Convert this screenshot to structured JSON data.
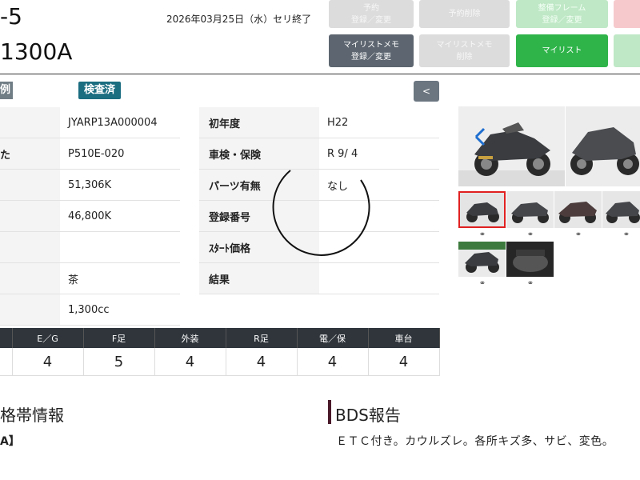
{
  "header": {
    "lot_no": "-5",
    "model": "1300A",
    "auction_date": "2026年03月25日（水）セリ終了"
  },
  "buttons": {
    "reserve": [
      "予約",
      "登録／変更"
    ],
    "reserve_delete": "予約削除",
    "frame": [
      "整備フレーム",
      "登録／変更"
    ],
    "mylist_memo": [
      "マイリストメモ",
      "登録／変更"
    ],
    "mylist_memo_delete": [
      "マイリストメモ",
      "削除"
    ],
    "mylist": "マイリスト"
  },
  "badges": {
    "example": "例",
    "inspected": "検査済",
    "collapse": "<"
  },
  "spec_left": [
    {
      "label": "",
      "value": "JYARP13A000004"
    },
    {
      "label": "",
      "value": "P510E-020"
    },
    {
      "label": "",
      "value": "51,306K"
    },
    {
      "label": "",
      "value": "46,800K"
    },
    {
      "label": "",
      "value": ""
    },
    {
      "label": "",
      "value": "茶"
    },
    {
      "label": "",
      "value": "1,300cc"
    }
  ],
  "spec_right": [
    {
      "label": "初年度",
      "value": "H22"
    },
    {
      "label": "車検・保険",
      "value": "R 9/ 4"
    },
    {
      "label": "パーツ有無",
      "value": "なし"
    },
    {
      "label": "登録番号",
      "value": ""
    },
    {
      "label": "ｽﾀｰﾄ価格",
      "value": ""
    },
    {
      "label": "結果",
      "value": ""
    }
  ],
  "spec_left_label_fragments": [
    "",
    "",
    "",
    "",
    "",
    "",
    ""
  ],
  "spec_left_label_fragment_2": "た",
  "grades": {
    "headers": [
      "",
      "E／G",
      "F足",
      "外装",
      "R足",
      "電／保",
      "車台"
    ],
    "values": [
      "",
      "4",
      "5",
      "4",
      "4",
      "4",
      "4"
    ]
  },
  "sections": {
    "left_title": "格帯情報",
    "left_sub": "A】",
    "right_title": "BDS報告",
    "report_text": "ＥＴＣ付き。カウルズレ。各所キズ多、サビ、変色。"
  },
  "icons": {
    "link": "link-icon",
    "loading": "spinner-icon"
  },
  "colors": {
    "green": "#2fb44a",
    "dark_button": "#5d6670",
    "inspected_badge": "#1b6d80",
    "selected_thumb_border": "#e02020",
    "grade_header": "#2f353b"
  }
}
